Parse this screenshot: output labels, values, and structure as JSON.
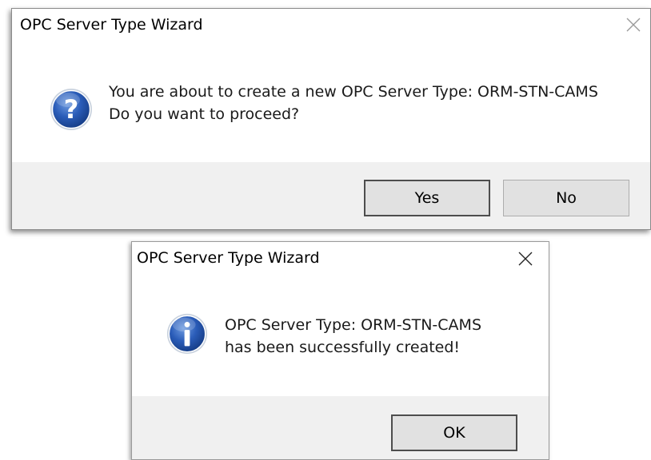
{
  "confirm_dialog": {
    "title": "OPC Server Type Wizard",
    "icon": "question-icon",
    "message_line1": "You are about to create a new OPC Server Type: ORM-STN-CAMS",
    "message_line2": "Do you want to proceed?",
    "yes_label": "Yes",
    "no_label": "No"
  },
  "info_dialog": {
    "title": "OPC Server Type Wizard",
    "icon": "information-icon",
    "message_line1": "OPC Server Type: ORM-STN-CAMS",
    "message_line2": "has been successfully created!",
    "ok_label": "OK"
  },
  "colors": {
    "footer_bg": "#f0f0f0",
    "button_bg": "#e1e1e1",
    "icon_blue": "#1f4fa8"
  }
}
